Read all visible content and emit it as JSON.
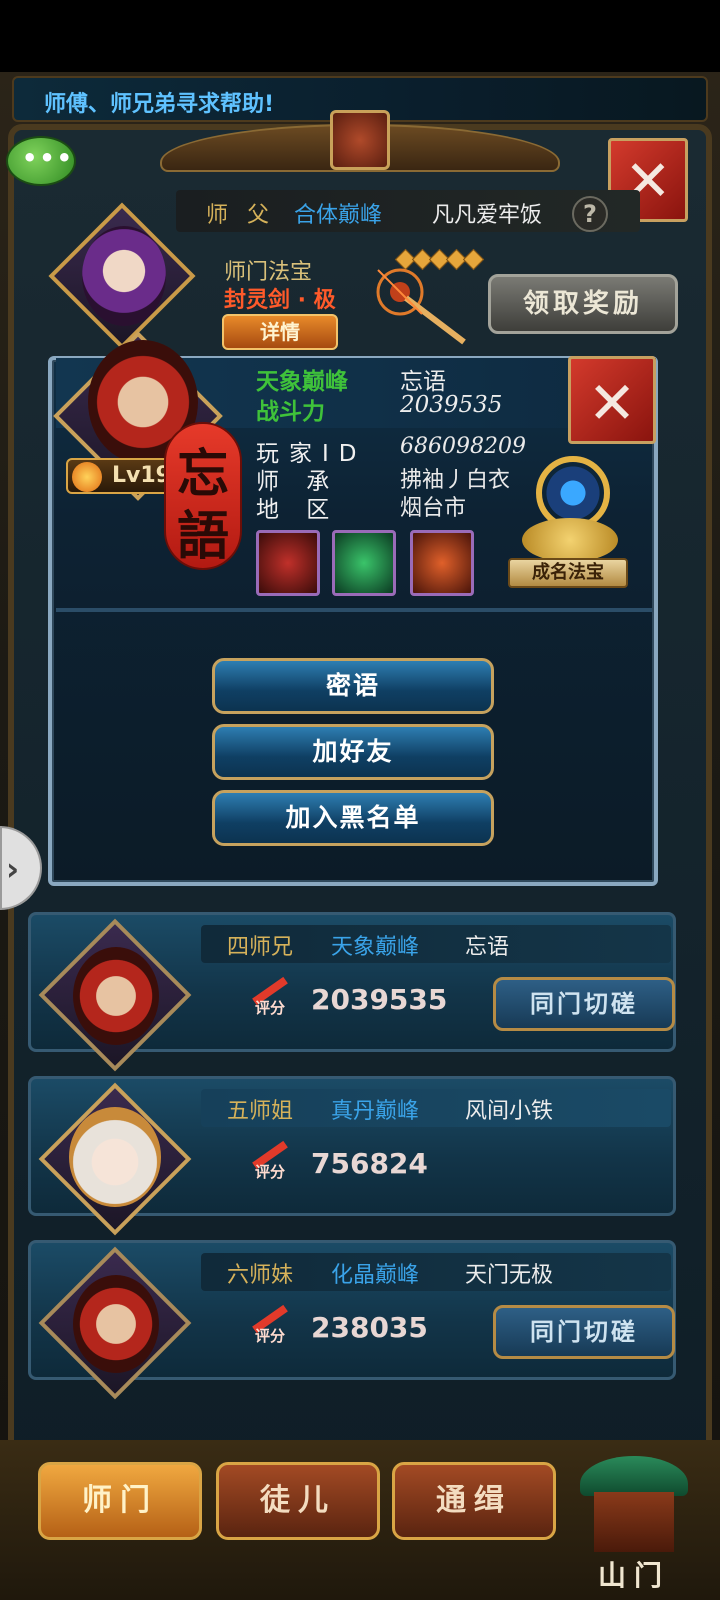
{
  "notice": "师傅、师兄弟寻求帮助!",
  "chat_icon_text": "•••",
  "master": {
    "label": "师  父",
    "realm": "合体巅峰",
    "name": "凡凡爱牢饭",
    "help_icon": "?"
  },
  "treasure": {
    "title": "师门法宝",
    "name": "封灵剑 · 极",
    "detail_button": "详情",
    "stars": 5,
    "claim_button": "领取奖励"
  },
  "close_glyph": "✕",
  "popup": {
    "realm": "天象巅峰",
    "name": "忘语",
    "power_label": "战斗力",
    "power_value": "2039535",
    "level": "Lv19",
    "seal_chars": [
      "忘",
      "語"
    ],
    "fields": [
      {
        "label": "玩家ID",
        "value": "686098209"
      },
      {
        "label": "师  承",
        "value": "拂袖丿白衣"
      },
      {
        "label": "地  区",
        "value": "烟台市"
      }
    ],
    "fame_treasure_label": "成名法宝",
    "actions": {
      "whisper": "密语",
      "add_friend": "加好友",
      "blacklist": "加入黑名单"
    }
  },
  "side_arrow": "›",
  "members": [
    {
      "rank": "四师兄",
      "realm": "天象巅峰",
      "name": "忘语",
      "rating_label": "评分",
      "power": "2039535",
      "button": "同门切磋"
    },
    {
      "rank": "五师姐",
      "realm": "真丹巅峰",
      "name": "风间小铁",
      "rating_label": "评分",
      "power": "756824",
      "button": ""
    },
    {
      "rank": "六师妹",
      "realm": "化晶巅峰",
      "name": "天门无极",
      "rating_label": "评分",
      "power": "238035",
      "button": "同门切磋"
    }
  ],
  "tabs": {
    "shimen": "师门",
    "tuer": "徒儿",
    "tongji": "通缉",
    "mountain_gate": "山门"
  },
  "colors": {
    "realm_green": "#3fc23a",
    "realm_blue": "#3aa3e8",
    "gold_label": "#d6b25a",
    "name_white": "#ececec"
  }
}
